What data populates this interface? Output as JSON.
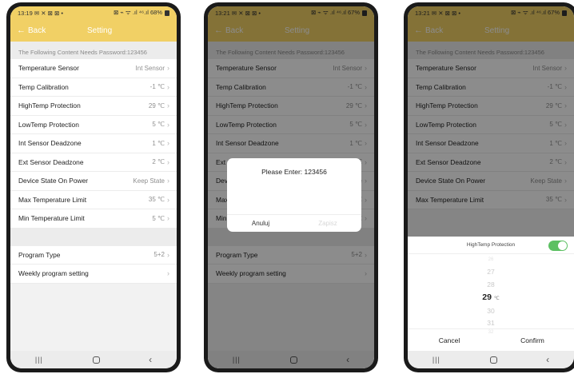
{
  "phones": [
    {
      "status": {
        "time": "13:19",
        "icons": "✉ ✕ ⊠ ⊠ •",
        "right": "⊠ ⌁ ᯤ .ıl ⁴⁶.ıl 68%"
      }
    },
    {
      "status": {
        "time": "13:21",
        "icons": "✉ ✕ ⊠ ⊠ •",
        "right": "⊠ ⌁ ᯤ .ıl ⁴⁶.ıl 67%"
      }
    },
    {
      "status": {
        "time": "13:21",
        "icons": "✉ ✕ ⊠ ⊠ •",
        "right": "⊠ ⌁ ᯤ .ıl ⁴⁶.ıl 67%"
      }
    }
  ],
  "header": {
    "back_label": "Back",
    "title": "Setting"
  },
  "settings": {
    "note": "The Following Content Needs Password:123456",
    "rows": [
      {
        "label": "Temperature Sensor",
        "value": "Int Sensor"
      },
      {
        "label": "Temp Calibration",
        "value": "-1 ℃"
      },
      {
        "label": "HighTemp Protection",
        "value": "29 ℃"
      },
      {
        "label": "LowTemp Protection",
        "value": "5 ℃"
      },
      {
        "label": "Int Sensor Deadzone",
        "value": "1 ℃"
      },
      {
        "label": "Ext Sensor Deadzone",
        "value": "2 ℃"
      },
      {
        "label": "Device State On Power",
        "value": "Keep State"
      },
      {
        "label": "Max Temperature Limit",
        "value": "35 ℃"
      },
      {
        "label": "Min Temperature Limit",
        "value": "5 ℃"
      }
    ],
    "program_rows": [
      {
        "label": "Program Type",
        "value": "5+2"
      },
      {
        "label": "Weekly program setting",
        "value": ""
      }
    ]
  },
  "dialog": {
    "title": "Please Enter: 123456",
    "cancel_label": "Anuluj",
    "ok_label": "Zapisz"
  },
  "picker": {
    "title": "HighTemp Protection",
    "enabled": true,
    "values": [
      "26",
      "27",
      "28",
      "29",
      "30",
      "31",
      "32"
    ],
    "selected": "29",
    "unit": "℃",
    "cancel_label": "Cancel",
    "confirm_label": "Confirm"
  },
  "colors": {
    "accent": "#f1d065",
    "toggle_on": "#5cc062"
  }
}
